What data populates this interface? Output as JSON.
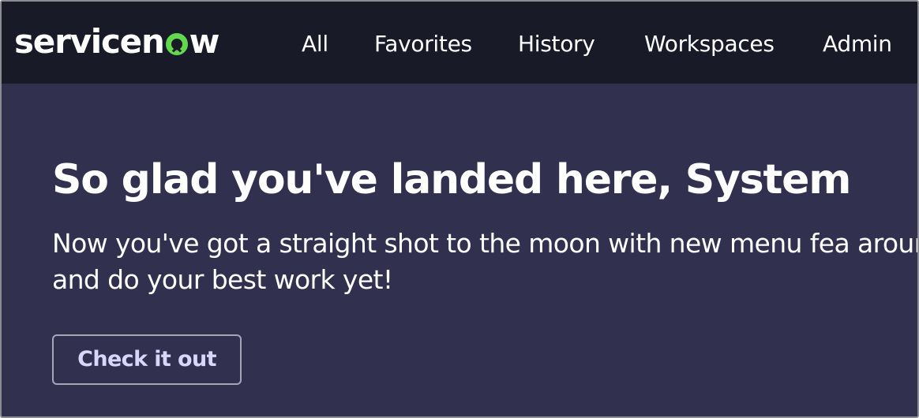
{
  "brand": {
    "name_before": "servicen",
    "name_after": "w",
    "logo_accent_color": "#62d84e",
    "icon": "servicenow-logo-icon"
  },
  "nav": {
    "items": [
      {
        "label": "All"
      },
      {
        "label": "Favorites"
      },
      {
        "label": "History"
      },
      {
        "label": "Workspaces"
      },
      {
        "label": "Admin"
      }
    ]
  },
  "hero": {
    "title": "So glad you've landed here, System",
    "subtitle": "Now you've got a straight shot to the moon with new menu fea around and do your best work yet!",
    "button_label": "Check it out"
  },
  "colors": {
    "nav_background": "#181a27",
    "hero_background": "#32304f",
    "button_text": "#d8d6fb"
  }
}
